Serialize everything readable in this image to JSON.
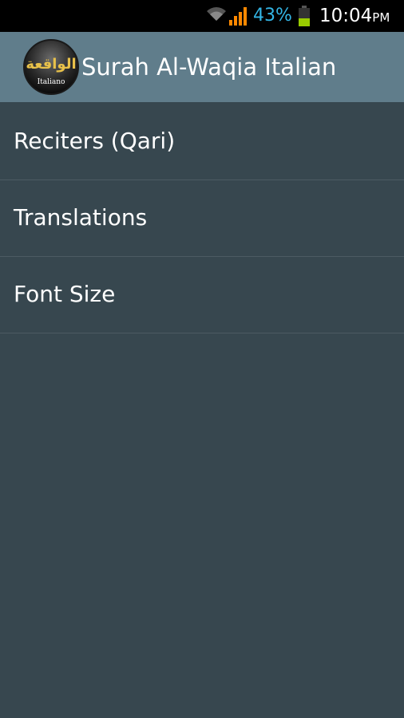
{
  "status_bar": {
    "battery_percent": "43%",
    "time": "10:04",
    "ampm": "PM",
    "battery_level": 0.43,
    "icons": [
      "wifi-icon",
      "signal-icon",
      "battery-icon"
    ]
  },
  "app_bar": {
    "title": "Surah Al-Waqia Italian",
    "logo": {
      "arabic_text": "الواقعة",
      "caption": "Italiano"
    }
  },
  "menu": {
    "items": [
      {
        "label": "Reciters (Qari)"
      },
      {
        "label": "Translations"
      },
      {
        "label": "Font Size"
      }
    ]
  },
  "colors": {
    "background": "#37474f",
    "app_bar": "#607d8b",
    "status_bar": "#000000",
    "accent": "#33b5e5",
    "signal": "#ff8800",
    "battery": "#99cc00",
    "divider": "#4c5b63"
  }
}
